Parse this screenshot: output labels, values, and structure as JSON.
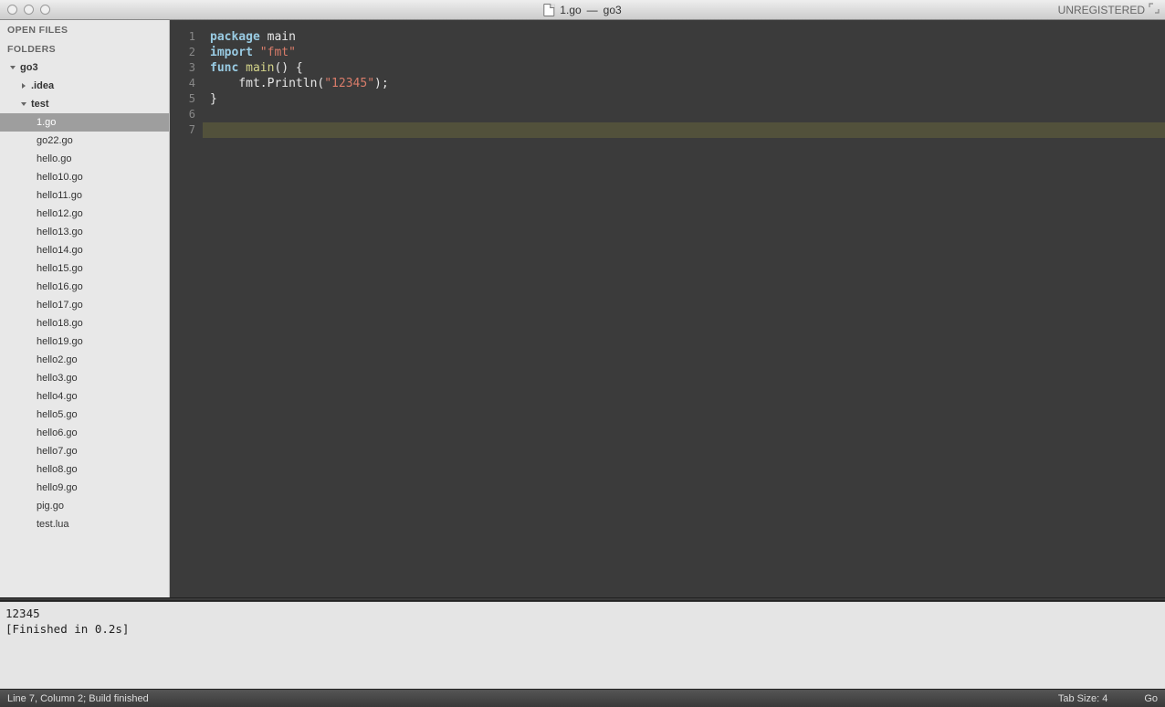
{
  "titlebar": {
    "filename": "1.go",
    "project": "go3",
    "separator": " — ",
    "unregistered": "UNREGISTERED"
  },
  "sidebar": {
    "open_files_header": "OPEN FILES",
    "folders_header": "FOLDERS",
    "tree": [
      {
        "label": "go3",
        "kind": "folder",
        "expanded": true,
        "indent": 0
      },
      {
        "label": ".idea",
        "kind": "folder",
        "expanded": false,
        "indent": 1
      },
      {
        "label": "test",
        "kind": "folder",
        "expanded": true,
        "indent": 1
      },
      {
        "label": "1.go",
        "kind": "file",
        "indent": 3,
        "selected": true
      },
      {
        "label": "go22.go",
        "kind": "file",
        "indent": 3
      },
      {
        "label": "hello.go",
        "kind": "file",
        "indent": 3
      },
      {
        "label": "hello10.go",
        "kind": "file",
        "indent": 3
      },
      {
        "label": "hello11.go",
        "kind": "file",
        "indent": 3
      },
      {
        "label": "hello12.go",
        "kind": "file",
        "indent": 3
      },
      {
        "label": "hello13.go",
        "kind": "file",
        "indent": 3
      },
      {
        "label": "hello14.go",
        "kind": "file",
        "indent": 3
      },
      {
        "label": "hello15.go",
        "kind": "file",
        "indent": 3
      },
      {
        "label": "hello16.go",
        "kind": "file",
        "indent": 3
      },
      {
        "label": "hello17.go",
        "kind": "file",
        "indent": 3
      },
      {
        "label": "hello18.go",
        "kind": "file",
        "indent": 3
      },
      {
        "label": "hello19.go",
        "kind": "file",
        "indent": 3
      },
      {
        "label": "hello2.go",
        "kind": "file",
        "indent": 3
      },
      {
        "label": "hello3.go",
        "kind": "file",
        "indent": 3
      },
      {
        "label": "hello4.go",
        "kind": "file",
        "indent": 3
      },
      {
        "label": "hello5.go",
        "kind": "file",
        "indent": 3
      },
      {
        "label": "hello6.go",
        "kind": "file",
        "indent": 3
      },
      {
        "label": "hello7.go",
        "kind": "file",
        "indent": 3
      },
      {
        "label": "hello8.go",
        "kind": "file",
        "indent": 3
      },
      {
        "label": "hello9.go",
        "kind": "file",
        "indent": 3
      },
      {
        "label": "pig.go",
        "kind": "file",
        "indent": 3
      },
      {
        "label": "test.lua",
        "kind": "file",
        "indent": 3
      }
    ]
  },
  "editor": {
    "gutter": [
      "1",
      "2",
      "3",
      "4",
      "5",
      "6",
      "7"
    ],
    "lines": [
      {
        "tokens": [
          {
            "t": "package ",
            "c": "kw-package"
          },
          {
            "t": "main",
            "c": "plain"
          }
        ]
      },
      {
        "tokens": [
          {
            "t": "",
            "c": "plain"
          }
        ]
      },
      {
        "tokens": [
          {
            "t": "import ",
            "c": "kw-import"
          },
          {
            "t": "\"fmt\"",
            "c": "str"
          }
        ]
      },
      {
        "tokens": [
          {
            "t": "",
            "c": "plain"
          }
        ]
      },
      {
        "tokens": [
          {
            "t": "func ",
            "c": "kw-func"
          },
          {
            "t": "main",
            "c": "ident-main"
          },
          {
            "t": "() {",
            "c": "punct"
          }
        ]
      },
      {
        "tokens": [
          {
            "t": "    fmt.Println(",
            "c": "plain"
          },
          {
            "t": "\"12345\"",
            "c": "str"
          },
          {
            "t": ");",
            "c": "punct"
          }
        ]
      },
      {
        "tokens": [
          {
            "t": "}",
            "c": "punct"
          }
        ],
        "highlight": true
      }
    ]
  },
  "console": {
    "line1": "12345",
    "line2": "[Finished in 0.2s]"
  },
  "status": {
    "left": "Line 7, Column 2; Build finished",
    "tab_size": "Tab Size: 4",
    "language": "Go"
  }
}
